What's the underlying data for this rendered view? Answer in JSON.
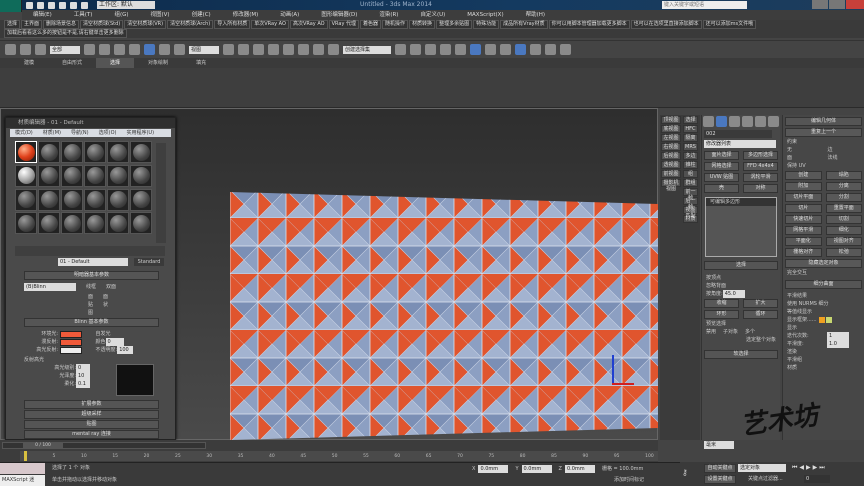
{
  "titlebar": {
    "workspace": "工作区: 默认",
    "title": "Untitled - 3ds Max 2014",
    "search_placeholder": "键入关键字或短语"
  },
  "menu": [
    "编辑(E)",
    "工具(T)",
    "组(G)",
    "视图(V)",
    "创建(C)",
    "修改器(M)",
    "动画(A)",
    "图形编辑器(D)",
    "渲染(R)",
    "自定义(U)",
    "MAXScript(X)",
    "帮助(H)"
  ],
  "plugins_row1": [
    "选择",
    "主界面",
    "删除场景信息",
    "清空材质球(Std)",
    "清空材质球(VR)",
    "清空材质球(Arch)",
    "导入所有材质",
    "单次VRay AO",
    "高次VRay AO",
    "VRay 代理",
    "着色器",
    "随机操作",
    "材质转换",
    "整理多余贴图",
    "特殊功能",
    "成品所有Vray材质",
    "你可以用脚本管理器加载更多脚本",
    "也可以在选项里直接添加脚本",
    "还可以添加ms文件哦"
  ],
  "plugins_row2": [
    "加载后看看这么多的按钮是不是,请右键单击更多删除"
  ],
  "toolbar": {
    "selection_filter": "全部",
    "ref_coord": "视图",
    "named_selection": "创建选择集"
  },
  "ribbon_tabs": [
    "建模",
    "自由形式",
    "选择",
    "对象绘制",
    "填充"
  ],
  "material_editor": {
    "title": "材质编辑器 - 01 - Default",
    "menus": [
      "模式(D)",
      "材质(M)",
      "导航(N)",
      "选项(O)",
      "实用程序(U)"
    ],
    "material_name": "01 - Default",
    "material_type": "Standard",
    "shader_section": "明暗器基本参数",
    "shader": "(B)Blinn",
    "checks": [
      "线框",
      "双面",
      "面贴图",
      "面状"
    ],
    "blinn_section": "Blinn 基本参数",
    "self_illum": "自发光",
    "color_label": "颜色",
    "color_value": "0",
    "ambient": "环境光:",
    "diffuse": "漫反射:",
    "specular": "高光反射:",
    "opacity_label": "不透明度:",
    "opacity": "100",
    "spec_section": "反射高光",
    "spec_level_label": "高光级别:",
    "spec_level": "0",
    "gloss_label": "光泽度:",
    "gloss": "10",
    "soften_label": "柔化:",
    "soften": "0.1",
    "rollouts": [
      "扩展参数",
      "超级采样",
      "贴图",
      "mental ray 连接"
    ],
    "ambient_color": "#f05a3a",
    "diffuse_color": "#f05a3a",
    "specular_color": "#eeeeee"
  },
  "command_left": [
    "顶视图",
    "底视图",
    "左视图",
    "右视图",
    "后视图",
    "透视图",
    "前视图",
    "摄影机视图"
  ],
  "command_left2": [
    "选择",
    "HFC",
    "隔离",
    "MRS",
    "多边",
    "锥柱",
    "组",
    "群组",
    "前一帧",
    "后一帧",
    "视图匹配",
    "材质"
  ],
  "command_panel": {
    "object_name": "002",
    "modifier_list": "修改器列表",
    "buttons": [
      "面片选择",
      "多边形选择",
      "网格选择",
      "FFD 4x4x4",
      "UVW 贴图",
      "涡轮平滑",
      "壳",
      "对称"
    ],
    "stack_item": "可编辑多边形",
    "selection": "选择",
    "sel_checks": [
      "按顶点",
      "忽略背面",
      "按角度:"
    ],
    "angle": "45.0",
    "shrink": "收缩",
    "grow": "扩大",
    "ring": "环形",
    "loop": "循环",
    "preview": "预览选择",
    "disabled": "禁用",
    "sub": "子对象",
    "multi": "多个",
    "sel_info": "选定整个对象",
    "soft_sel": "软选择"
  },
  "modify_panel": {
    "title": "编辑几何体",
    "repeat": "重复上一个",
    "constraints": "约束",
    "c_none": "无",
    "c_edge": "边",
    "c_face": "面",
    "c_normal": "法线",
    "preserve_uv": "保持 UV",
    "create": "创建",
    "collapse": "塌陷",
    "attach": "附加",
    "detach": "分离",
    "slice_plane": "切片平面",
    "split": "分割",
    "slice": "切片",
    "reset_plane": "重置平面",
    "quickslice": "快速切片",
    "cut": "切割",
    "msmooth": "网格平滑",
    "tessellate": "细化",
    "planarize": "平面化",
    "view_align": "视图对齐",
    "grid_align": "栅格对齐",
    "relax": "松弛",
    "hide_sel": "隐藏选定对象",
    "full_interactive": "完全交互",
    "subdiv_title": "细分曲面",
    "smooth_result": "平滑结果",
    "use_nurms": "使用 NURMS 细分",
    "isoline": "等值线显示",
    "show_cage": "显示框架......",
    "display": "显示",
    "iterations_label": "迭代次数:",
    "iterations": "1",
    "smoothness_label": "平滑度:",
    "smoothness": "1.0",
    "render": "渲染",
    "smooth_group": "平滑组",
    "material": "材质"
  },
  "timeline": {
    "frame": "0 / 100",
    "ticks": [
      "0",
      "5",
      "10",
      "15",
      "20",
      "25",
      "30",
      "35",
      "40",
      "45",
      "50",
      "55",
      "60",
      "65",
      "70",
      "75",
      "80",
      "85",
      "90",
      "95",
      "100"
    ]
  },
  "status": {
    "maxscript": "MAXScript 迷",
    "selected": "选择了 1 个 对象",
    "hint": "单击并拖动以选择并移动对象",
    "x": "0.0mm",
    "y": "0.0mm",
    "z": "0.0mm",
    "grid": "栅格 = 100.0mm",
    "add_time_tag": "添加时间标记",
    "auto_key": "自动关键点",
    "set_key": "设置关键点",
    "key_filter": "选定对象",
    "key_filters_btn": "关键点过滤器...",
    "frame_input": "0",
    "units": "毫米"
  },
  "watermark": "艺术坊"
}
